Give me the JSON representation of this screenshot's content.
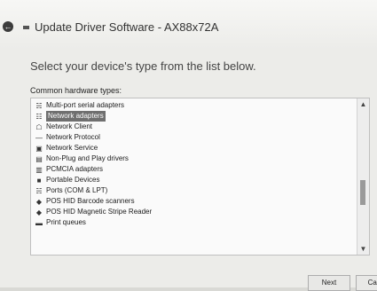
{
  "window": {
    "title": "Update Driver Software - AX88x72A",
    "back_icon": "back-arrow-icon"
  },
  "main": {
    "heading": "Select your device's type from the list below.",
    "section_label": "Common hardware types:"
  },
  "list": {
    "selected_index": 1,
    "items": [
      {
        "label": "Multi-port serial adapters",
        "icon": "serial-port-icon"
      },
      {
        "label": "Network adapters",
        "icon": "network-adapter-icon"
      },
      {
        "label": "Network Client",
        "icon": "network-client-icon"
      },
      {
        "label": "Network Protocol",
        "icon": "network-protocol-icon"
      },
      {
        "label": "Network Service",
        "icon": "network-service-icon"
      },
      {
        "label": "Non-Plug and Play drivers",
        "icon": "device-icon"
      },
      {
        "label": "PCMCIA adapters",
        "icon": "pcmcia-icon"
      },
      {
        "label": "Portable Devices",
        "icon": "portable-device-icon"
      },
      {
        "label": "Ports (COM & LPT)",
        "icon": "port-icon"
      },
      {
        "label": "POS HID Barcode scanners",
        "icon": "barcode-scanner-icon"
      },
      {
        "label": "POS HID Magnetic Stripe Reader",
        "icon": "stripe-reader-icon"
      },
      {
        "label": "Print queues",
        "icon": "printer-icon"
      }
    ]
  },
  "buttons": {
    "next": "Next",
    "cancel": "Can"
  }
}
